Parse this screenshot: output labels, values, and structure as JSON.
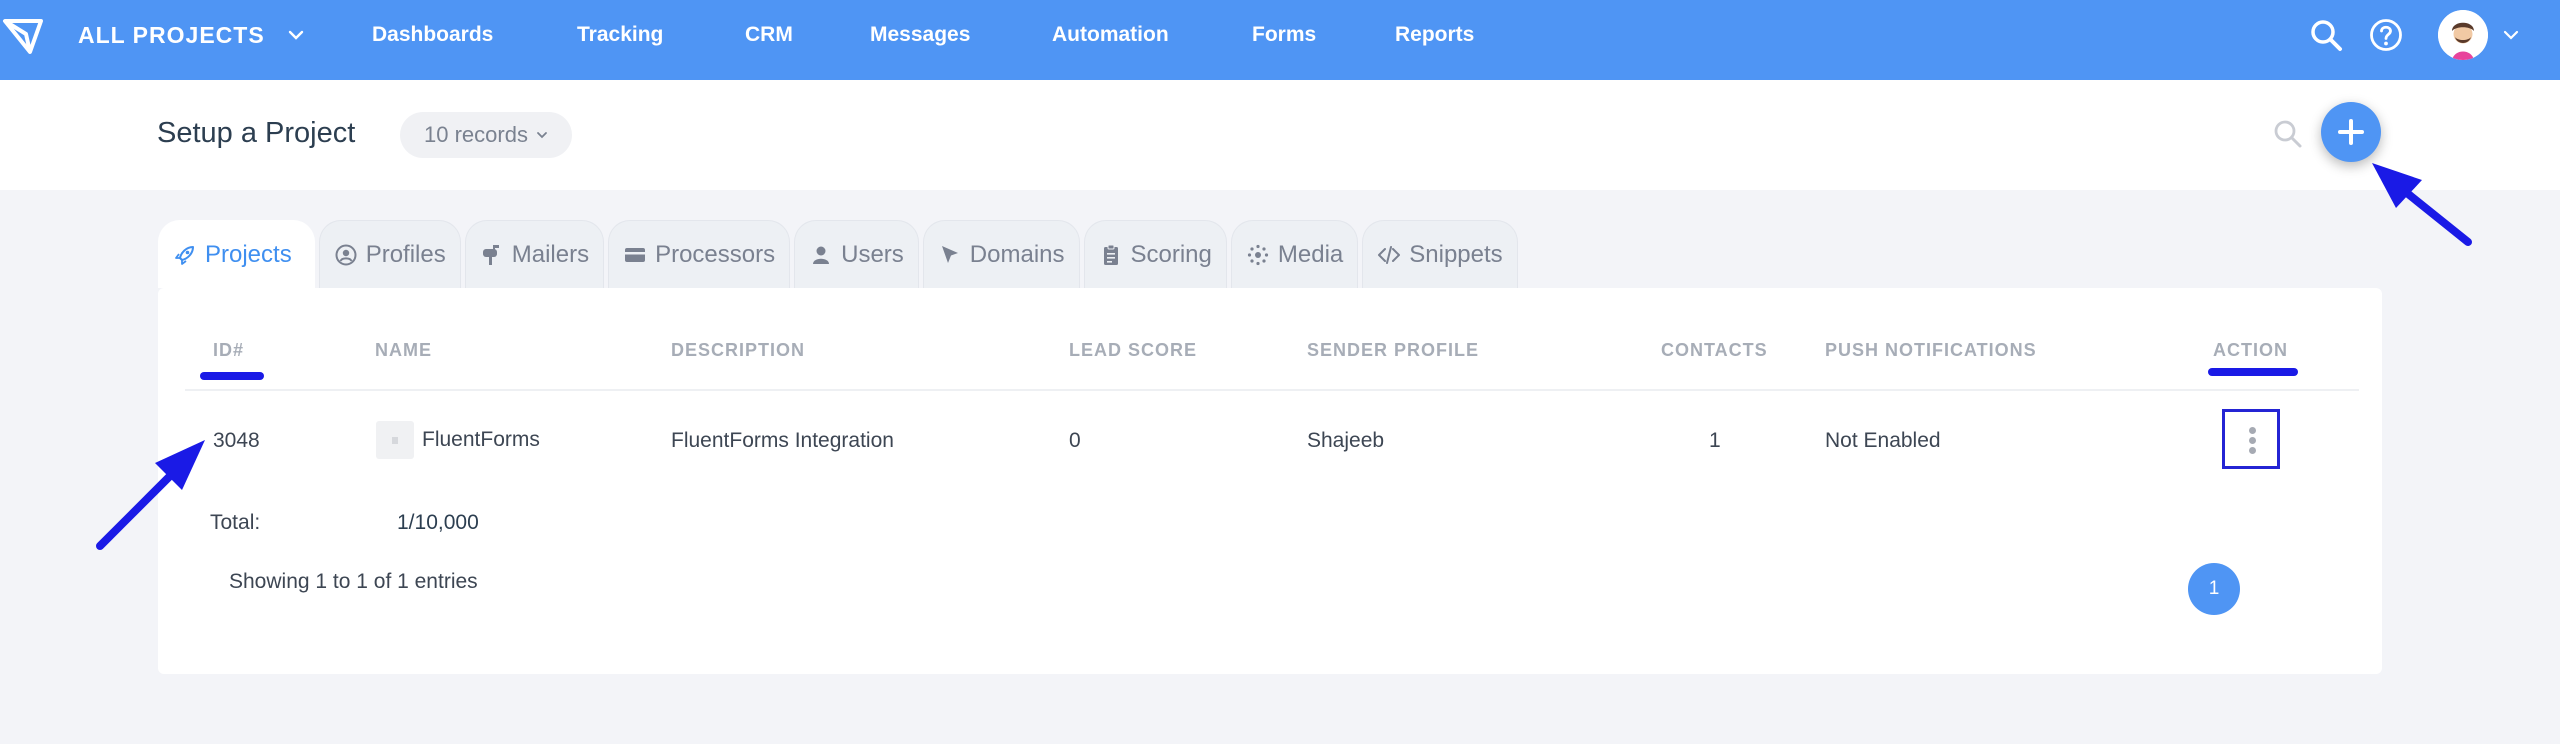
{
  "navbar": {
    "project_switcher": "ALL PROJECTS",
    "links": [
      "Dashboards",
      "Tracking",
      "CRM",
      "Messages",
      "Automation",
      "Forms",
      "Reports"
    ],
    "icons": [
      "search-icon",
      "help-icon",
      "avatar",
      "chevron-down-icon"
    ]
  },
  "page": {
    "title": "Setup a Project",
    "records": "10 records",
    "add_icon": "plus-icon",
    "search_icon": "search-icon"
  },
  "tabs": [
    {
      "label": "Projects",
      "icon": "rocket-icon",
      "active": true
    },
    {
      "label": "Profiles",
      "icon": "user-circle-icon"
    },
    {
      "label": "Mailers",
      "icon": "mailbox-icon"
    },
    {
      "label": "Processors",
      "icon": "credit-card-icon"
    },
    {
      "label": "Users",
      "icon": "user-icon"
    },
    {
      "label": "Domains",
      "icon": "cursor-icon"
    },
    {
      "label": "Scoring",
      "icon": "clipboard-icon"
    },
    {
      "label": "Media",
      "icon": "media-icon"
    },
    {
      "label": "Snippets",
      "icon": "code-icon"
    }
  ],
  "table": {
    "columns": [
      "ID#",
      "NAME",
      "DESCRIPTION",
      "LEAD SCORE",
      "SENDER PROFILE",
      "CONTACTS",
      "PUSH NOTIFICATIONS",
      "ACTION"
    ],
    "rows": [
      {
        "id": "3048",
        "name": "FluentForms",
        "description": "FluentForms Integration",
        "lead_score": "0",
        "sender_profile": "Shajeeb",
        "contacts": "1",
        "push_notifications": "Not Enabled"
      }
    ],
    "total_label": "Total:",
    "total_value": "1/10,000",
    "showing": "Showing 1 to 1 of 1 entries",
    "pages": [
      "1"
    ]
  },
  "colors": {
    "navbar": "#4f95f4",
    "accent": "#3f8ff0",
    "annotation": "#1a1ae6"
  }
}
